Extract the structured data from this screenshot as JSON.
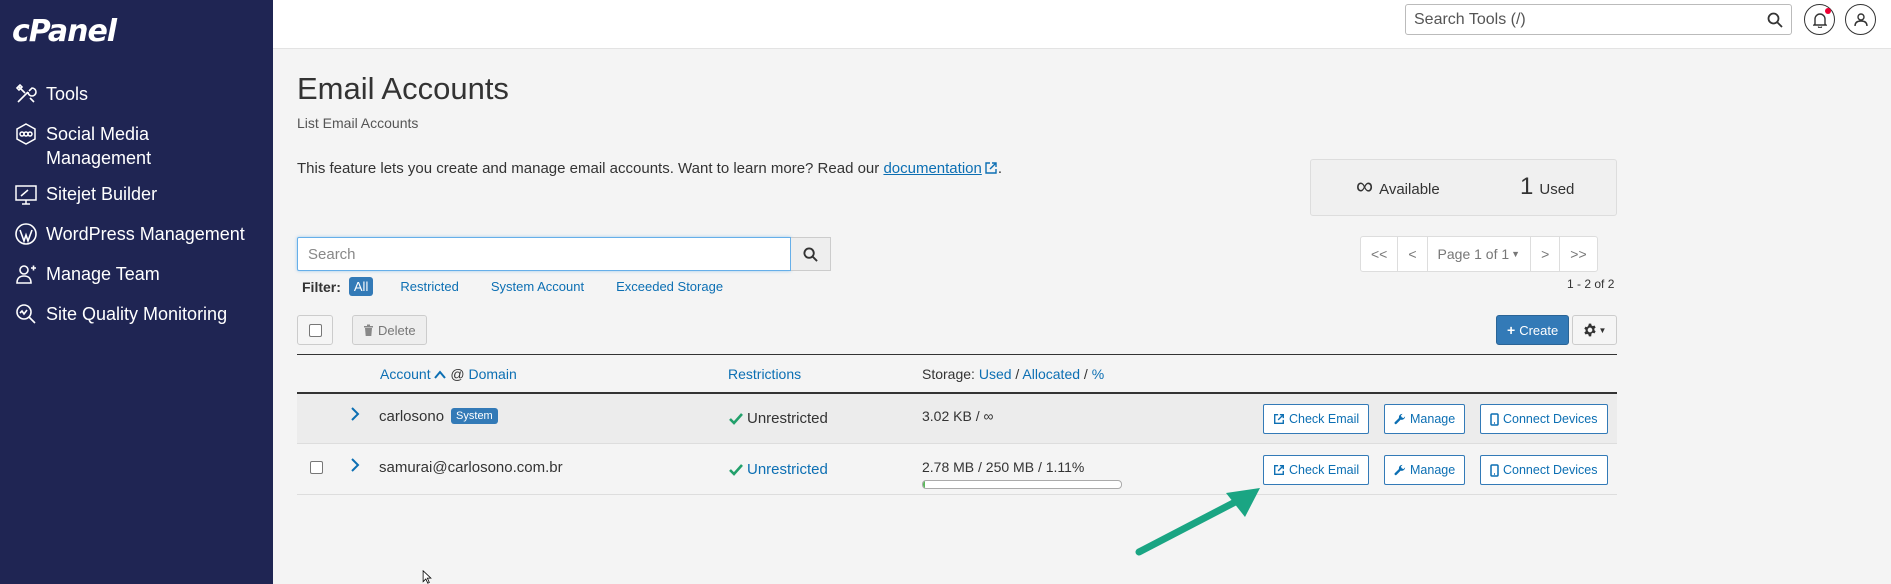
{
  "brand": {
    "logo_text": "cPanel"
  },
  "sidebar": {
    "items": [
      {
        "label": "Tools",
        "icon": "tools-icon"
      },
      {
        "label": "Social Media\nManagement",
        "icon": "social-media-icon"
      },
      {
        "label": "Sitejet Builder",
        "icon": "sitejet-icon"
      },
      {
        "label": "WordPress Management",
        "icon": "wordpress-icon"
      },
      {
        "label": "Manage Team",
        "icon": "team-icon"
      },
      {
        "label": "Site Quality Monitoring",
        "icon": "site-quality-icon"
      }
    ]
  },
  "topbar": {
    "search_placeholder": "Search Tools (/)",
    "notification_icon": "bell-icon",
    "user_icon": "user-icon"
  },
  "page": {
    "title": "Email Accounts",
    "subtitle": "List Email Accounts",
    "intro_text": "This feature lets you create and manage email accounts. Want to learn more? Read our",
    "intro_link": "documentation",
    "intro_end": "."
  },
  "stats": {
    "available_value": "∞",
    "available_label": "Available",
    "used_value": "1",
    "used_label": "Used"
  },
  "search": {
    "placeholder": "Search"
  },
  "filter": {
    "label": "Filter:",
    "options": [
      "All",
      "Restricted",
      "System Account",
      "Exceeded Storage"
    ],
    "selected": "All"
  },
  "pagination": {
    "first": "<<",
    "prev": "<",
    "page_label": "Page 1 of 1",
    "next": ">",
    "last": ">>",
    "range_text": "1 - 2 of 2"
  },
  "toolbar": {
    "delete_label": "Delete",
    "create_label": "Create"
  },
  "table": {
    "headers": {
      "account": "Account",
      "at": "@",
      "domain": "Domain",
      "restrictions": "Restrictions",
      "storage": "Storage:",
      "used": "Used",
      "slash1": "/",
      "allocated": "Allocated",
      "slash2": "/",
      "percent": "%"
    },
    "rows": [
      {
        "account": "carlosono",
        "badge": "System",
        "restriction": "Unrestricted",
        "storage": "3.02 KB / ∞",
        "check_email": "Check Email",
        "manage": "Manage",
        "connect": "Connect Devices"
      },
      {
        "account": "samurai@carlosono.com.br",
        "restriction": "Unrestricted",
        "storage": "2.78 MB / 250 MB / 1.11%",
        "usage_percent": 1.11,
        "check_email": "Check Email",
        "manage": "Manage",
        "connect": "Connect Devices"
      }
    ]
  },
  "colors": {
    "sidebar_bg": "#1f2553",
    "link": "#0c6fb3",
    "primary": "#337ab7",
    "success": "#22a06b",
    "annotation_arrow": "#1aa583"
  }
}
